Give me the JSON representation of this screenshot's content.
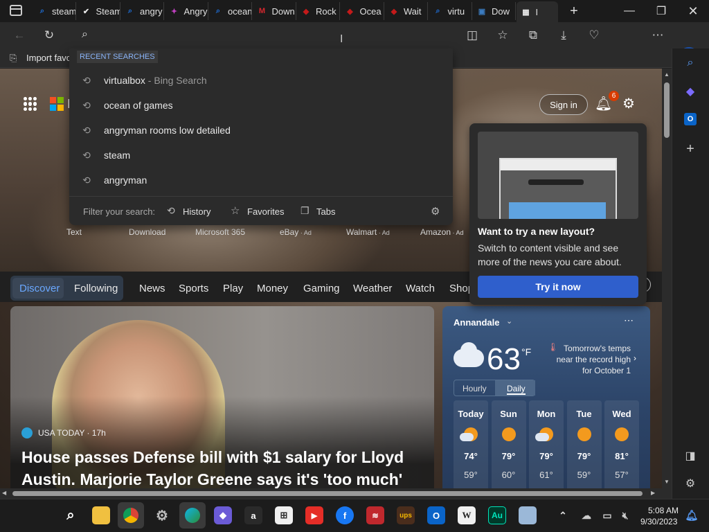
{
  "tabs": [
    {
      "label": "steam",
      "icon": "bing-search-icon",
      "color": "#1e6fd9"
    },
    {
      "label": "Steam",
      "icon": "steam-icon",
      "color": "#e8e8e8"
    },
    {
      "label": "angry",
      "icon": "bing-search-icon",
      "color": "#1e6fd9"
    },
    {
      "label": "Angry",
      "icon": "angry-game-icon",
      "color": "#c040c0"
    },
    {
      "label": "ocean",
      "icon": "bing-search-icon",
      "color": "#1e6fd9"
    },
    {
      "label": "Down",
      "icon": "mega-icon",
      "color": "#d9272e"
    },
    {
      "label": "Rock",
      "icon": "rockstar-icon",
      "color": "#c41a1a"
    },
    {
      "label": "Ocea",
      "icon": "rockstar-icon",
      "color": "#c41a1a"
    },
    {
      "label": "Wait",
      "icon": "rockstar-icon",
      "color": "#c41a1a"
    },
    {
      "label": "virtu",
      "icon": "bing-search-icon",
      "color": "#1e6fd9"
    },
    {
      "label": "Dow",
      "icon": "virtualbox-icon",
      "color": "#3b7bc0"
    },
    {
      "label": "I",
      "icon": "new-tab-icon",
      "color": "#e8e8e8"
    }
  ],
  "favorites_bar": {
    "import_label": "Import favo"
  },
  "dropdown": {
    "header": "RECENT SEARCHES",
    "items": [
      {
        "text": "virtualbox",
        "suffix": " - Bing Search"
      },
      {
        "text": "ocean of games",
        "suffix": ""
      },
      {
        "text": "angryman rooms low detailed",
        "suffix": ""
      },
      {
        "text": "steam",
        "suffix": ""
      },
      {
        "text": "angryman",
        "suffix": ""
      }
    ],
    "filter_label": "Filter your search:",
    "filters": [
      "History",
      "Favorites",
      "Tabs"
    ]
  },
  "header": {
    "brand_letter": "I",
    "sign_in": "Sign in",
    "notification_count": "6"
  },
  "quick_links": [
    {
      "label": "Text",
      "ad": ""
    },
    {
      "label": "Download",
      "ad": ""
    },
    {
      "label": "Microsoft 365",
      "ad": ""
    },
    {
      "label": "eBay",
      "ad": " · Ad"
    },
    {
      "label": "Walmart",
      "ad": " · Ad"
    },
    {
      "label": "Amazon",
      "ad": " · Ad"
    }
  ],
  "nav": {
    "discover": "Discover",
    "following": "Following",
    "items": [
      "News",
      "Sports",
      "Play",
      "Money",
      "Gaming",
      "Weather",
      "Watch",
      "Shop"
    ]
  },
  "flyout": {
    "title": "Want to try a new layout?",
    "body": "Switch to content visible and see more of the news you care about.",
    "button": "Try it now"
  },
  "news": {
    "source": "USA TODAY · 17h",
    "headline": "House passes Defense bill with $1 salary for Lloyd Austin. Marjorie Taylor Greene says it's 'too much'"
  },
  "weather": {
    "location": "Annandale",
    "temperature": "63",
    "unit": "°F",
    "note": "Tomorrow's temps near the record high for October 1",
    "tabs": [
      "Hourly",
      "Daily"
    ],
    "days": [
      {
        "day": "Today",
        "high": "74°",
        "low": "59°",
        "icon": "partly-cloudy-sun-icon"
      },
      {
        "day": "Sun",
        "high": "79°",
        "low": "60°",
        "icon": "sun-icon"
      },
      {
        "day": "Mon",
        "high": "79°",
        "low": "61°",
        "icon": "partly-cloudy-sun-icon"
      },
      {
        "day": "Tue",
        "high": "79°",
        "low": "59°",
        "icon": "sun-icon"
      },
      {
        "day": "Wed",
        "high": "81°",
        "low": "57°",
        "icon": "sun-icon"
      }
    ]
  },
  "taskbar": {
    "time": "5:08 AM",
    "date": "9/30/2023"
  }
}
